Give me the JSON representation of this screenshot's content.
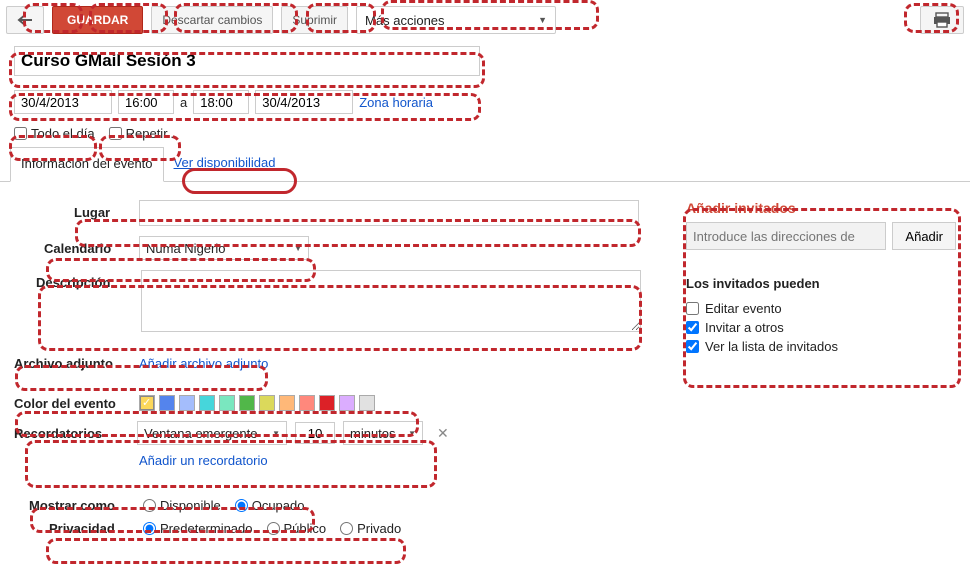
{
  "toolbar": {
    "save": "GUARDAR",
    "discard": "Descartar cambios",
    "delete": "Suprimir",
    "more_actions": "Más acciones"
  },
  "event": {
    "title": "Curso GMail Sesión 3",
    "date_from": "30/4/2013",
    "time_from": "16:00",
    "sep": "a",
    "time_to": "18:00",
    "date_to": "30/4/2013",
    "timezone_link": "Zona horaria",
    "all_day": "Todo el día",
    "repeat": "Repetir..."
  },
  "tabs": {
    "info": "Información del evento",
    "availability": "Ver disponibilidad"
  },
  "fields": {
    "location_label": "Lugar",
    "location_value": "",
    "calendar_label": "Calendario",
    "calendar_value": "Numa Nigerio",
    "description_label": "Descripción",
    "description_value": "",
    "attachment_label": "Archivo adjunto",
    "attachment_link": "Añadir archivo adjunto",
    "color_label": "Color del evento",
    "reminders_label": "Recordatorios",
    "reminder_type": "Ventana emergente",
    "reminder_value": "10",
    "reminder_unit": "minutos",
    "add_reminder": "Añadir un recordatorio",
    "show_as_label": "Mostrar como",
    "show_as_available": "Disponible",
    "show_as_busy": "Ocupado",
    "privacy_label": "Privacidad",
    "privacy_default": "Predeterminado",
    "privacy_public": "Público",
    "privacy_private": "Privado"
  },
  "colors": [
    "#fbd75b",
    "#5484ed",
    "#a4bdfc",
    "#46d6db",
    "#7ae7bf",
    "#51b749",
    "#dbd95b",
    "#ffb878",
    "#ff887c",
    "#dc2127",
    "#dbadff",
    "#e1e1e1"
  ],
  "guests": {
    "title": "Añadir invitados",
    "placeholder": "Introduce las direcciones de",
    "add": "Añadir",
    "perm_title": "Los invitados pueden",
    "perm_edit": "Editar evento",
    "perm_invite": "Invitar a otros",
    "perm_seelist": "Ver la lista de invitados"
  }
}
